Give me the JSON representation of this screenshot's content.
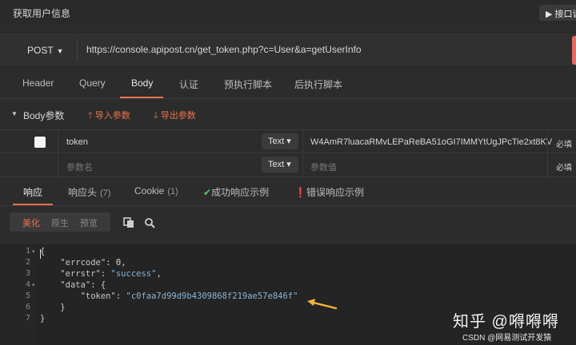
{
  "window": {
    "title": "获取用户信息",
    "doc_button": "▶ 接口说"
  },
  "request": {
    "method": "POST",
    "url": "https://console.apipost.cn/get_token.php?c=User&a=getUserInfo"
  },
  "tabs": [
    "Header",
    "Query",
    "Body",
    "认证",
    "预执行脚本",
    "后执行脚本"
  ],
  "body_section": {
    "label": "Body参数",
    "import_label": "导入参数",
    "export_label": "导出参数"
  },
  "params": [
    {
      "key": "token",
      "type": "Text",
      "value": "W4AmR7luacaRMvLEPaReBA51oGI7IMMYtUgJPcTie2xt8KV",
      "required": "必填"
    },
    {
      "key_placeholder": "参数名",
      "type": "Text",
      "value_placeholder": "参数值",
      "required": "必填"
    }
  ],
  "response_tabs": {
    "response": "响应",
    "headers": "响应头",
    "headers_count": "(7)",
    "cookie": "Cookie",
    "cookie_count": "(1)",
    "success_example": "成功响应示例",
    "error_example": "错误响应示例"
  },
  "view_modes": [
    "美化",
    "原生",
    "预览"
  ],
  "code_lines": [
    {
      "num": "1",
      "fold": true,
      "text": "{"
    },
    {
      "num": "2",
      "fold": false,
      "text": "    \"errcode\": 0,"
    },
    {
      "num": "3",
      "fold": false,
      "text": "    \"errstr\": \"success\","
    },
    {
      "num": "4",
      "fold": true,
      "text": "    \"data\": {"
    },
    {
      "num": "5",
      "fold": false,
      "text": "        \"token\": \"c0faa7d99d9b4309868f219ae57e846f\""
    },
    {
      "num": "6",
      "fold": false,
      "text": "    }"
    },
    {
      "num": "7",
      "fold": false,
      "text": "}"
    }
  ],
  "watermark": {
    "primary": "知乎 @嘚嘚嘚",
    "secondary": "CSDN @网易测试开发猿"
  },
  "colors": {
    "accent": "#e9724c",
    "success": "#5ec270",
    "arrow": "#f0b43c"
  }
}
